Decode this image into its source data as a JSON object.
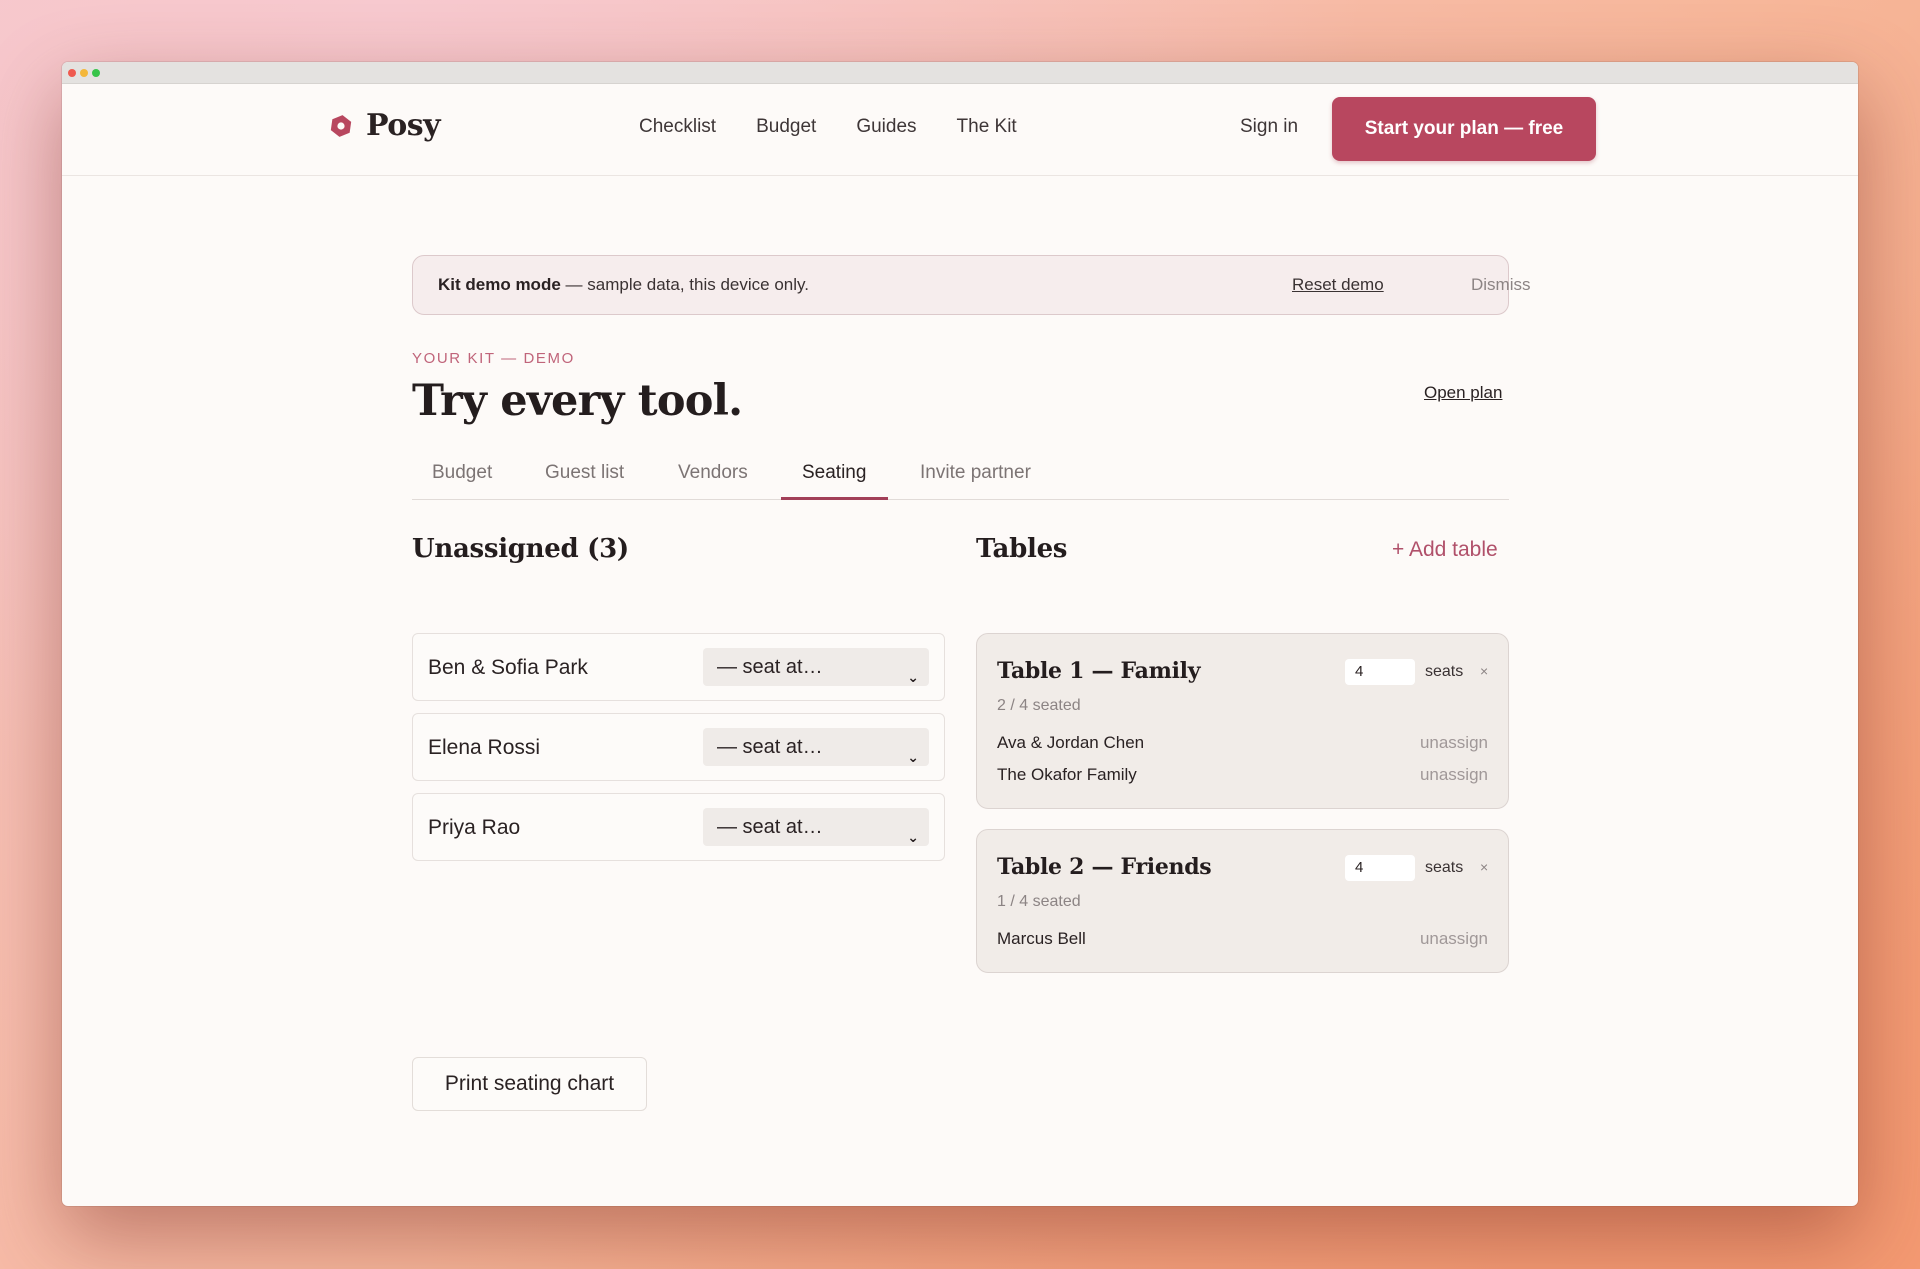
{
  "brand": {
    "name": "Posy",
    "accent": "#b8475f"
  },
  "nav": {
    "links": [
      "Checklist",
      "Budget",
      "Guides",
      "The Kit"
    ],
    "signin": "Sign in",
    "cta": "Start your plan — free"
  },
  "banner": {
    "bold": "Kit demo mode",
    "text": " — sample data, this device only.",
    "reset": "Reset demo",
    "dismiss": "Dismiss"
  },
  "hero": {
    "kicker": "YOUR KIT — DEMO",
    "title": "Try every tool.",
    "open_plan": "Open plan"
  },
  "tabs": [
    {
      "label": "Budget",
      "active": false
    },
    {
      "label": "Guest list",
      "active": false
    },
    {
      "label": "Vendors",
      "active": false
    },
    {
      "label": "Seating",
      "active": true
    },
    {
      "label": "Invite partner",
      "active": false
    }
  ],
  "unassigned": {
    "heading": "Unassigned (3)",
    "select_placeholder": "— seat at…",
    "guests": [
      "Ben & Sofia Park",
      "Elena Rossi",
      "Priya Rao"
    ]
  },
  "tables_section": {
    "heading": "Tables",
    "add": "+ Add table",
    "seats_label": "seats",
    "remove_glyph": "×",
    "unassign_label": "unassign",
    "tables": [
      {
        "name": "Table 1 — Family",
        "seats": "4",
        "count": "2 / 4 seated",
        "guests": [
          "Ava & Jordan Chen",
          "The Okafor Family"
        ]
      },
      {
        "name": "Table 2 — Friends",
        "seats": "4",
        "count": "1 / 4 seated",
        "guests": [
          "Marcus Bell"
        ]
      }
    ]
  },
  "print": "Print seating chart"
}
